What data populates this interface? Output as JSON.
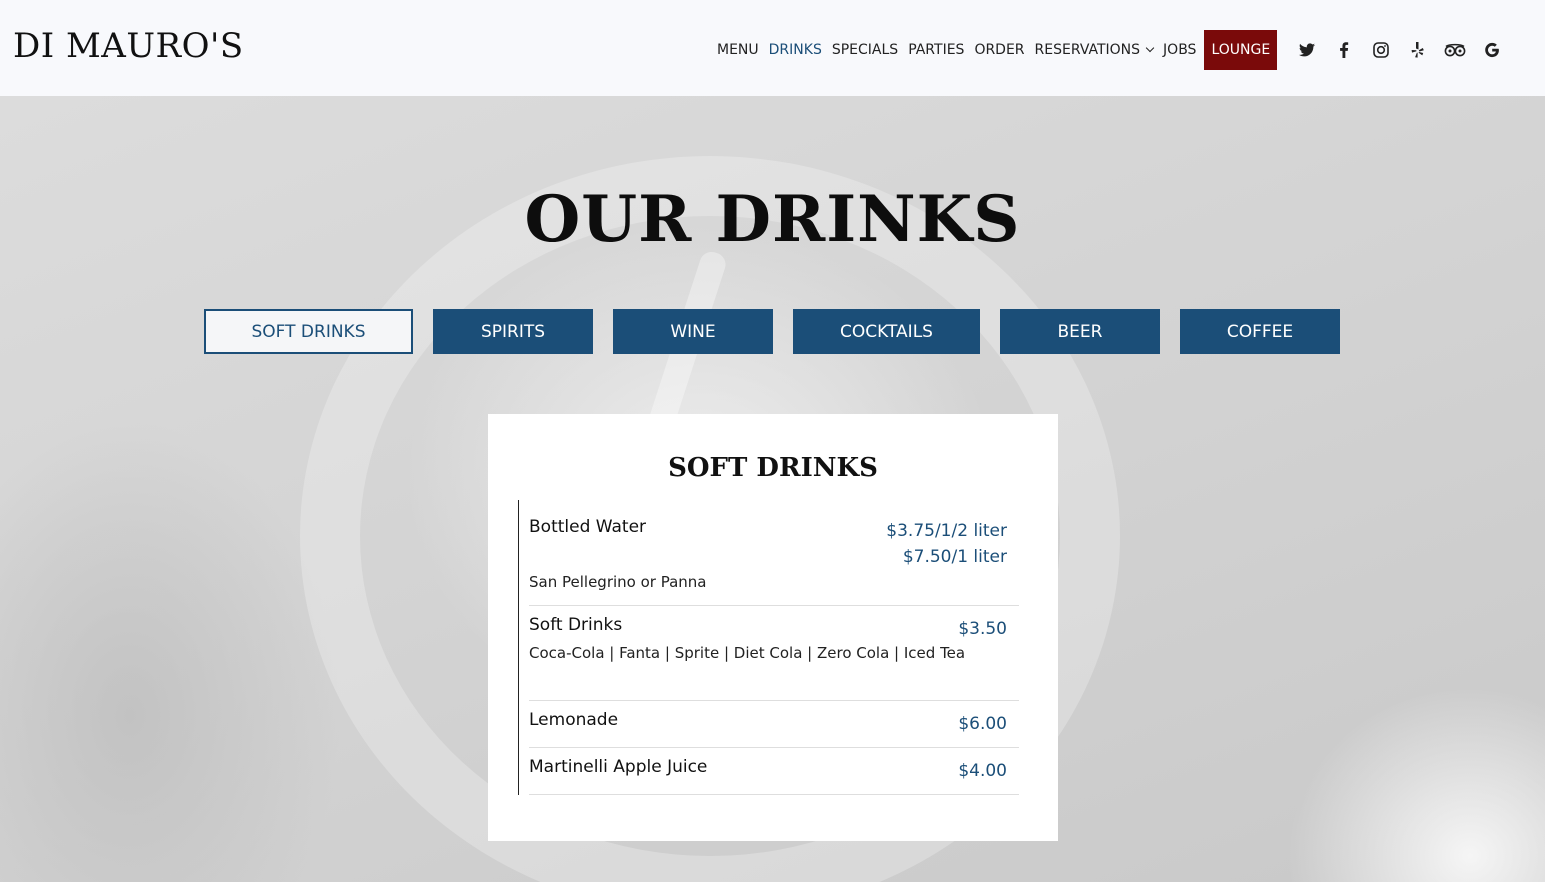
{
  "header": {
    "logo": "DI MAURO'S",
    "nav": [
      {
        "label": "MENU",
        "active": false
      },
      {
        "label": "DRINKS",
        "active": true
      },
      {
        "label": "SPECIALS",
        "active": false
      },
      {
        "label": "PARTIES",
        "active": false
      },
      {
        "label": "ORDER",
        "active": false
      },
      {
        "label": "RESERVATIONS",
        "active": false
      },
      {
        "label": "JOBS",
        "active": false
      },
      {
        "label": "LOUNGE",
        "active": false
      }
    ],
    "social_icons": [
      "twitter-icon",
      "facebook-icon",
      "instagram-icon",
      "yelp-icon",
      "tripadvisor-icon",
      "google-icon"
    ]
  },
  "page": {
    "title": "OUR DRINKS",
    "tabs": [
      {
        "label": "SOFT DRINKS",
        "active": true
      },
      {
        "label": "SPIRITS",
        "active": false
      },
      {
        "label": "WINE",
        "active": false
      },
      {
        "label": "COCKTAILS",
        "active": false
      },
      {
        "label": "BEER",
        "active": false
      },
      {
        "label": "COFFEE",
        "active": false
      }
    ]
  },
  "card": {
    "title": "SOFT DRINKS",
    "items": [
      {
        "name": "Bottled Water",
        "price_line_1": "$3.75/1/2 liter",
        "price_line_2": "$7.50/1 liter",
        "description": "San Pellegrino or Panna"
      },
      {
        "name": "Soft Drinks",
        "price": "$3.50",
        "description": "Coca-Cola | Fanta | Sprite | Diet Cola | Zero Cola | Iced Tea"
      },
      {
        "name": "Lemonade",
        "price": "$6.00"
      },
      {
        "name": "Martinelli Apple Juice",
        "price": "$4.00"
      }
    ]
  },
  "colors": {
    "accent_blue": "#1b4e78",
    "lounge_red": "#7a0a0a",
    "header_bg": "#f8f9fc"
  }
}
